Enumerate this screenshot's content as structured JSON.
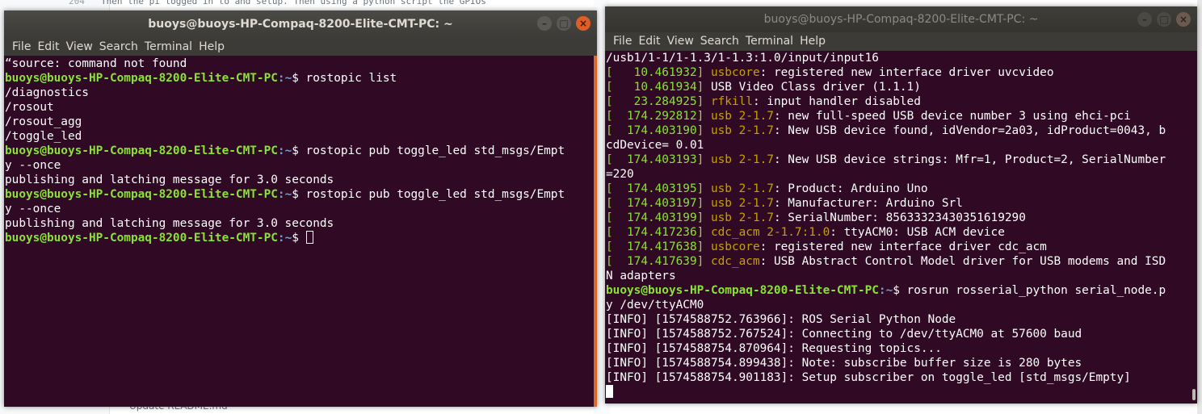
{
  "background": {
    "line_number": "204",
    "line_text": "Then the pi logged in to and setup. Then using a python script the GPIOs",
    "footer_text": "Update README.md"
  },
  "left_terminal": {
    "title": "buoys@buoys-HP-Compaq-8200-Elite-CMT-PC: ~",
    "menu": [
      "File",
      "Edit",
      "View",
      "Search",
      "Terminal",
      "Help"
    ],
    "prompt_user": "buoys@buoys-HP-Compaq-8200-Elite-CMT-PC",
    "prompt_path": ":~",
    "lines": {
      "l1": "“source: command not found",
      "cmd1": "$ rostopic list",
      "l3": "/diagnostics",
      "l4": "/rosout",
      "l5": "/rosout_agg",
      "l6": "/toggle_led",
      "cmd2a": "$ rostopic pub toggle_led std_msgs/Empt",
      "cmd2b": "y --once",
      "l9": "publishing and latching message for 3.0 seconds",
      "cmd3a": "$ rostopic pub toggle_led std_msgs/Empt",
      "cmd3b": "y --once",
      "l12": "publishing and latching message for 3.0 seconds",
      "cmd4": "$ "
    },
    "window_buttons": {
      "minimize": "–",
      "maximize": "□",
      "close": "×"
    }
  },
  "right_terminal": {
    "title": "buoys@buoys-HP-Compaq-8200-Elite-CMT-PC: ~",
    "menu": [
      "File",
      "Edit",
      "View",
      "Search",
      "Terminal",
      "Help"
    ],
    "prompt_user": "buoys@buoys-HP-Compaq-8200-Elite-CMT-PC",
    "prompt_path": ":~",
    "first_line": "/usb1/1-1/1-1.3/1-1.3:1.0/input/input16",
    "dmesg": [
      {
        "ts": "[   10.461932]",
        "dev": "usbcore",
        "msg": ": registered new interface driver uvcvideo"
      },
      {
        "ts": "[   10.461934]",
        "dev": "",
        "msg": "USB Video Class driver (1.1.1)"
      },
      {
        "ts": "[   23.284925]",
        "dev": "rfkill",
        "msg": ": input handler disabled"
      },
      {
        "ts": "[  174.292812]",
        "dev": "usb 2-1.7",
        "msg": ": new full-speed USB device number 3 using ehci-pci"
      },
      {
        "ts": "[  174.403190]",
        "dev": "usb 2-1.7",
        "msg": ": New USB device found, idVendor=2a03, idProduct=0043, b"
      },
      {
        "ts": "",
        "dev": "",
        "msg": "cdDevice= 0.01"
      },
      {
        "ts": "[  174.403193]",
        "dev": "usb 2-1.7",
        "msg": ": New USB device strings: Mfr=1, Product=2, SerialNumber"
      },
      {
        "ts": "",
        "dev": "",
        "msg": "=220"
      },
      {
        "ts": "[  174.403195]",
        "dev": "usb 2-1.7",
        "msg": ": Product: Arduino Uno"
      },
      {
        "ts": "[  174.403197]",
        "dev": "usb 2-1.7",
        "msg": ": Manufacturer: Arduino Srl"
      },
      {
        "ts": "[  174.403199]",
        "dev": "usb 2-1.7",
        "msg": ": SerialNumber: 85633323430351619290"
      },
      {
        "ts": "[  174.417236]",
        "dev": "cdc_acm 2-1.7:1.0",
        "msg": ": ttyACM0: USB ACM device"
      },
      {
        "ts": "[  174.417638]",
        "dev": "usbcore",
        "msg": ": registered new interface driver cdc_acm"
      },
      {
        "ts": "[  174.417639]",
        "dev": "cdc_acm",
        "msg": ": USB Abstract Control Model driver for USB modems and ISD"
      },
      {
        "ts": "",
        "dev": "",
        "msg": "N adapters"
      }
    ],
    "cmd_a": "$ rosrun rosserial_python serial_node.p",
    "cmd_b": "y /dev/ttyACM0",
    "info": [
      "[INFO] [1574588752.763966]: ROS Serial Python Node",
      "[INFO] [1574588752.767524]: Connecting to /dev/ttyACM0 at 57600 baud",
      "[INFO] [1574588754.870964]: Requesting topics...",
      "[INFO] [1574588754.899438]: Note: subscribe buffer size is 280 bytes",
      "[INFO] [1574588754.901183]: Setup subscriber on toggle_led [std_msgs/Empty]"
    ],
    "window_buttons": {
      "minimize": "–",
      "maximize": "□",
      "close": "×"
    }
  }
}
